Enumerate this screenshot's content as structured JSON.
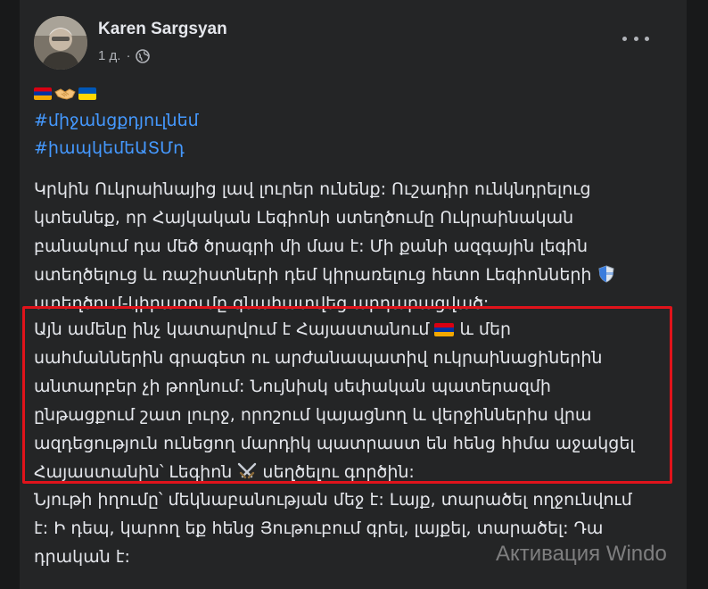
{
  "post": {
    "author": "Karen Sargsyan",
    "time": "1 д.",
    "separator": "·",
    "emoji_line": [
      "armenia-flag",
      "handshake",
      "ukraine-flag"
    ],
    "hashtags": [
      "#միջանցքդյուլնեմ",
      "#իապկեմեԱՏՄդ"
    ],
    "paragraph1": [
      "Կրկին Ուկրաինայից լավ լուրեր ունենք: Ուշադիր ունկնդրելուց",
      "կտեսնեք, որ Հայկական Լեգիոնի ստեղծումը Ուկրաինական",
      "բանակում դա մեծ ծրագրի մի մաս է: Մի քանի ազգային լեգին",
      "ստեղծելուց և ռաշիստների դեմ կիրառելուց հետո Լեգիոնների",
      "ստեղծում-կիրառումը գնահատվեց արդարացված:"
    ],
    "paragraph2": [
      "Այն ամենը ինչ կատարվում է Հայաստանում",
      "և մեր",
      "սահմաններին գրագետ ու արժանապատիվ ուկրաինացիներին",
      "անտարբեր չի թողնում: Նույնիսկ սեփական պատերազմի",
      "ընթացքում շատ լուրջ, որոշում կայացնող և վերջիններիս վրա",
      "ազդեցություն ունեցող մարդիկ պատրաստ են հենց հիմա աջակցել",
      "Հայաստանին՝ Լեգիոն",
      "սեղծելու գործին:"
    ],
    "paragraph3": [
      "Նյութի իղումը՝ մեկնաբանության մեջ է: Լայք, տարածել ողջունվում",
      "է: Ի դեպ, կարող եք հենց Յութուբում գրել, լայքել, տարածել: Դա",
      "դրական է:"
    ]
  },
  "watermark": "Активация Windo",
  "colors": {
    "background": "#18191a",
    "card": "#242526",
    "text": "#e4e6eb",
    "muted": "#b0b3b8",
    "link": "#4599ff",
    "highlight": "#e0131b"
  }
}
